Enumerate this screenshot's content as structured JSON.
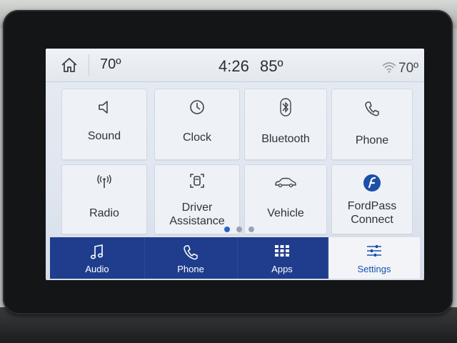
{
  "status_bar": {
    "outside_temp": "70º",
    "time": "4:26",
    "interior_temp": "85º",
    "right_temp": "70º"
  },
  "tiles": [
    {
      "label": "Sound",
      "icon": "speaker-icon"
    },
    {
      "label": "Clock",
      "icon": "clock-icon"
    },
    {
      "label": "Bluetooth",
      "icon": "bluetooth-icon"
    },
    {
      "label": "Phone",
      "icon": "phone-icon"
    },
    {
      "label": "Radio",
      "icon": "radio-antenna-icon"
    },
    {
      "label_line1": "Driver",
      "label_line2": "Assistance",
      "icon": "driver-assist-icon"
    },
    {
      "label": "Vehicle",
      "icon": "car-icon"
    },
    {
      "label_line1": "FordPass",
      "label_line2": "Connect",
      "icon": "fordpass-logo-icon"
    }
  ],
  "pager": {
    "total": 3,
    "active": 0
  },
  "nav": [
    {
      "label": "Audio",
      "icon": "music-note-icon"
    },
    {
      "label": "Phone",
      "icon": "phone-icon"
    },
    {
      "label": "Apps",
      "icon": "grid-icon"
    },
    {
      "label": "Settings",
      "icon": "sliders-icon",
      "active": true
    }
  ],
  "colors": {
    "nav_background": "#1f3d8c",
    "active_label": "#1a4fb0",
    "screen_background": "#e6ebf2"
  }
}
